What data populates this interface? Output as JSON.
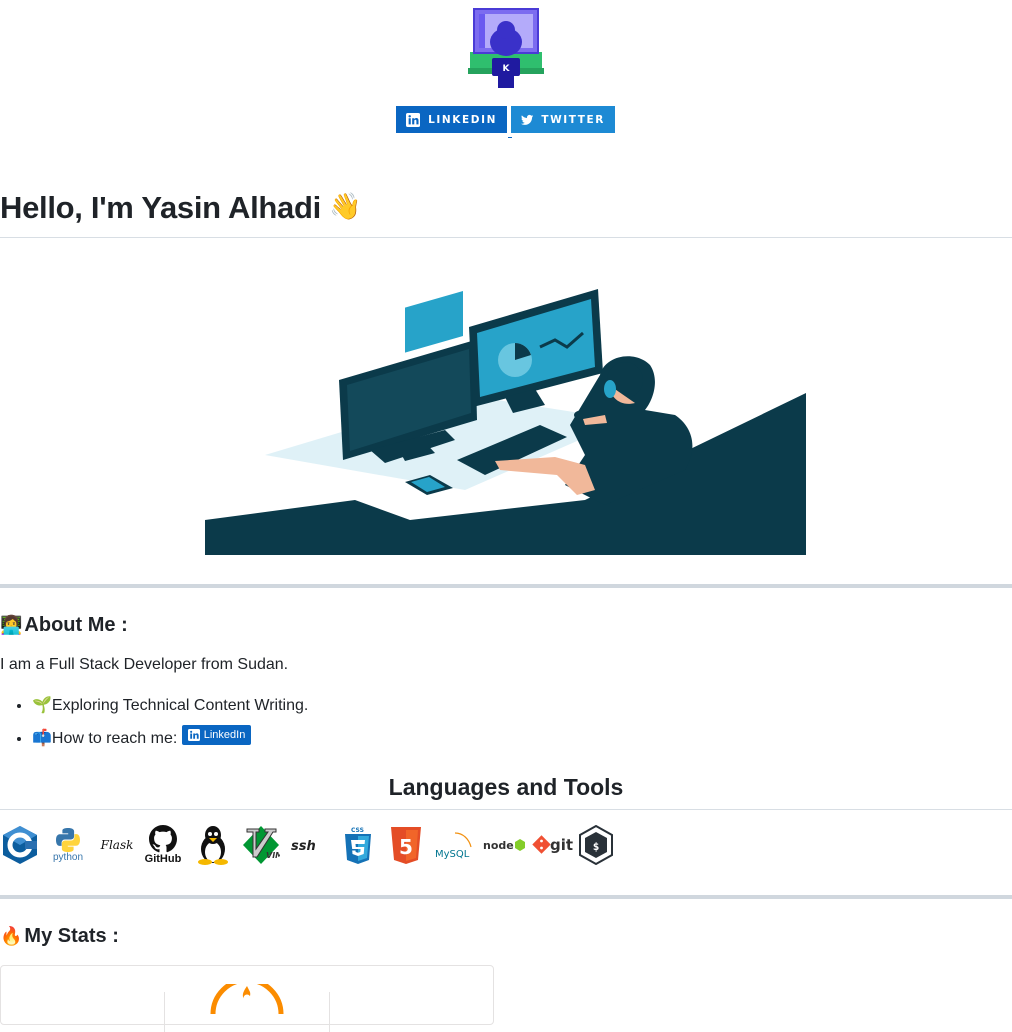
{
  "badges": {
    "linkedin": "LINKEDIN",
    "twitter": "TWITTER"
  },
  "logo": {
    "letter": "K",
    "icon": "developer-at-computer-logo"
  },
  "heading": {
    "text": "Hello, I'm Yasin Alhadi",
    "emoji": "👋"
  },
  "hero": {
    "icon": "developer-at-desk-illustration"
  },
  "about": {
    "title": "About Me :",
    "emoji": "👩‍💻",
    "intro": "I am a Full Stack Developer from Sudan.",
    "items": [
      {
        "emoji": "🌱",
        "text": "Exploring Technical Content Writing."
      },
      {
        "emoji": "📫",
        "text": "How to reach me: "
      }
    ],
    "badge_label": "LinkedIn"
  },
  "languages": {
    "title": "Languages and Tools",
    "tools": [
      {
        "name": "c",
        "label": "C"
      },
      {
        "name": "python",
        "label": "python"
      },
      {
        "name": "flask",
        "label": "Flask"
      },
      {
        "name": "github",
        "label": "GitHub"
      },
      {
        "name": "linux",
        "label": ""
      },
      {
        "name": "vim",
        "label": "VIM"
      },
      {
        "name": "ssh",
        "label": "ssh"
      },
      {
        "name": "css3",
        "label": "CSS"
      },
      {
        "name": "html5",
        "label": "5"
      },
      {
        "name": "mysql",
        "label": "MySQL"
      },
      {
        "name": "nodejs",
        "label": "node"
      },
      {
        "name": "git",
        "label": "git"
      },
      {
        "name": "bash",
        "label": "$"
      }
    ]
  },
  "stats": {
    "title": "My Stats :",
    "emoji": "🔥"
  },
  "colors": {
    "linkedin": "#0a66c2",
    "twitter": "#1d8ad4",
    "illustration_dark": "#0b3a4a",
    "illustration_accent": "#27a3c9"
  }
}
